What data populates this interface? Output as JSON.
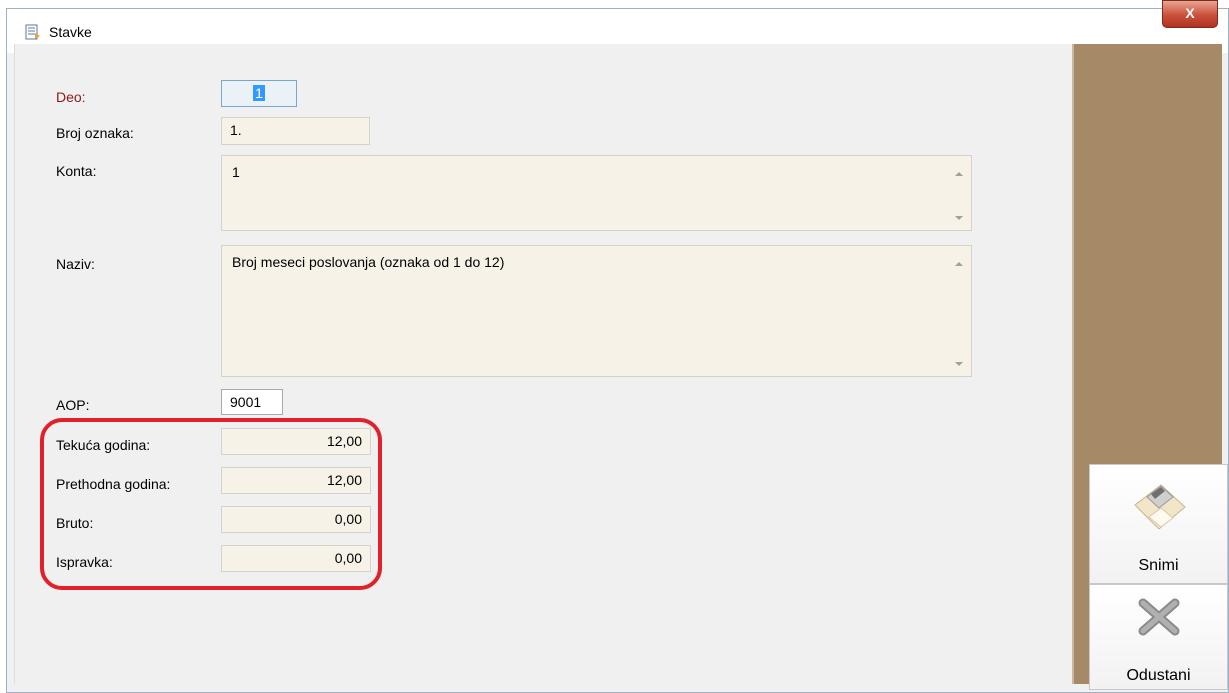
{
  "window": {
    "title": "Stavke",
    "close_label": "X"
  },
  "form": {
    "deo": {
      "label": "Deo:",
      "value": "1"
    },
    "broj_oznaka": {
      "label": "Broj oznaka:",
      "value": "1."
    },
    "konta": {
      "label": "Konta:",
      "value": "1"
    },
    "naziv": {
      "label": "Naziv:",
      "value": "Broj meseci poslovanja (oznaka od 1 do 12)"
    },
    "aop": {
      "label": "AOP:",
      "value": "9001"
    },
    "tekuca_godina": {
      "label": "Tekuća godina:",
      "value": "12,00"
    },
    "prethodna_godina": {
      "label": "Prethodna godina:",
      "value": "12,00"
    },
    "bruto": {
      "label": "Bruto:",
      "value": "0,00"
    },
    "ispravka": {
      "label": "Ispravka:",
      "value": "0,00"
    }
  },
  "actions": {
    "save": {
      "label": "Snimi",
      "icon": "floppy-disk-icon"
    },
    "cancel": {
      "label": "Odustani",
      "icon": "close-x-icon"
    }
  },
  "colors": {
    "highlight": "#e0202a",
    "side_panel": "#a68a68",
    "required_label": "#8b1a1a"
  }
}
